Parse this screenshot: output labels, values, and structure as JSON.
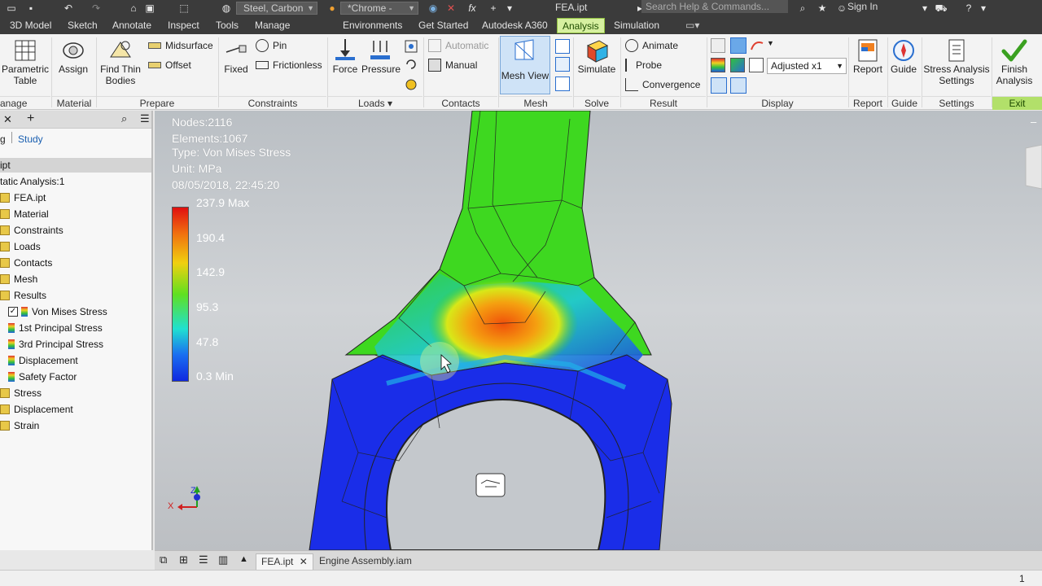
{
  "titlebar": {
    "material": "Steel, Carbon",
    "appearance": "*Chrome -",
    "title": "FEA.ipt",
    "search_placeholder": "Search Help & Commands...",
    "sign_in": "Sign In"
  },
  "ribbon_tabs": [
    "3D Model",
    "Sketch",
    "Annotate",
    "Inspect",
    "Tools",
    "Manage",
    "Environments",
    "Get Started",
    "Autodesk A360",
    "Analysis",
    "Simulation"
  ],
  "active_tab": "Analysis",
  "ribbon": {
    "parametric_table": "Parametric Table",
    "assign": "Assign",
    "find_thin_bodies": "Find Thin Bodies",
    "midsurface": "Midsurface",
    "offset": "Offset",
    "fixed": "Fixed",
    "pin": "Pin",
    "frictionless": "Frictionless",
    "force": "Force",
    "pressure": "Pressure",
    "automatic": "Automatic",
    "manual": "Manual",
    "mesh_view": "Mesh View",
    "simulate": "Simulate",
    "animate": "Animate",
    "probe": "Probe",
    "convergence": "Convergence",
    "adjusted": "Adjusted x1",
    "report": "Report",
    "guide": "Guide",
    "stress_settings": "Stress Analysis Settings",
    "finish_analysis": "Finish Analysis",
    "groups": {
      "manage": "anage",
      "material": "Material",
      "prepare": "Prepare",
      "constraints": "Constraints",
      "loads": "Loads",
      "contacts": "Contacts",
      "mesh": "Mesh",
      "solve": "Solve",
      "result": "Result",
      "display": "Display",
      "report": "Report",
      "guide": "Guide",
      "settings": "Settings",
      "exit": "Exit"
    }
  },
  "browser": {
    "tabs": [
      "g",
      "Study"
    ],
    "tree": [
      {
        "label": "ipt",
        "indent": 0
      },
      {
        "label": "tatic Analysis:1",
        "indent": 0
      },
      {
        "label": "FEA.ipt",
        "indent": 1
      },
      {
        "label": "Material",
        "indent": 1
      },
      {
        "label": "Constraints",
        "indent": 1
      },
      {
        "label": "Loads",
        "indent": 1
      },
      {
        "label": "Contacts",
        "indent": 1
      },
      {
        "label": "Mesh",
        "indent": 1
      },
      {
        "label": "Results",
        "indent": 1
      },
      {
        "label": "Von Mises Stress",
        "indent": 2
      },
      {
        "label": "1st Principal Stress",
        "indent": 2
      },
      {
        "label": "3rd Principal Stress",
        "indent": 2
      },
      {
        "label": "Displacement",
        "indent": 2
      },
      {
        "label": "Safety Factor",
        "indent": 2
      },
      {
        "label": "Stress",
        "indent": 1
      },
      {
        "label": "Displacement",
        "indent": 1
      },
      {
        "label": "Strain",
        "indent": 1
      }
    ]
  },
  "viewport": {
    "nodes": "Nodes:2116",
    "elements": "Elements:1067",
    "type": "Type: Von Mises Stress",
    "unit": "Unit: MPa",
    "timestamp": "08/05/2018, 22:45:20",
    "legend": [
      "237.9 Max",
      "190.4",
      "142.9",
      "95.3",
      "47.8",
      "0.3 Min"
    ],
    "axis_x": "X",
    "axis_z": "Z"
  },
  "doc_tabs": [
    "FEA.ipt",
    "Engine Assembly.iam"
  ],
  "status": {
    "count": "1"
  }
}
